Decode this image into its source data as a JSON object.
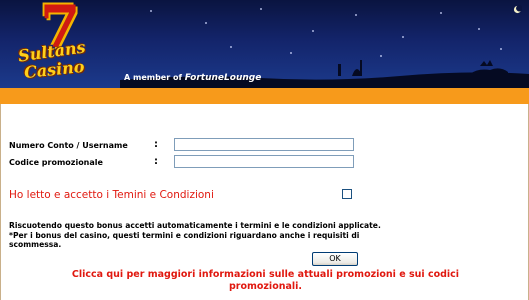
{
  "header": {
    "logo": {
      "number": "7",
      "line1": "Sultans",
      "line2": "Casino"
    },
    "member_prefix": "A member of",
    "member_brand": "FortuneLounge"
  },
  "form": {
    "account_label": "Numero Conto / Username",
    "promo_label": "Codice promozionale",
    "colon": ":",
    "account_value": "",
    "promo_value": "",
    "terms_label": "Ho letto e accetto i Temini e Condizioni",
    "terms_checked": false,
    "note_line1": "Riscuotendo questo bonus accetti automaticamente i termini e le condizioni applicate.",
    "note_line2": "*Per i bonus del casino, questi termini e condizioni riguardano anche i requisiti di",
    "note_line3": "scommessa.",
    "ok_label": "OK",
    "promo_link_line1": "Clicca qui per maggiori informazioni sulle attuali promozioni e sui codici",
    "promo_link_line2": "promozionali."
  },
  "colors": {
    "banner_dark": "#0a1440",
    "orange_bar": "#f79a1b",
    "red_text": "#e0180f",
    "logo_gold": "#ffd01a",
    "logo_red": "#d11a12"
  }
}
